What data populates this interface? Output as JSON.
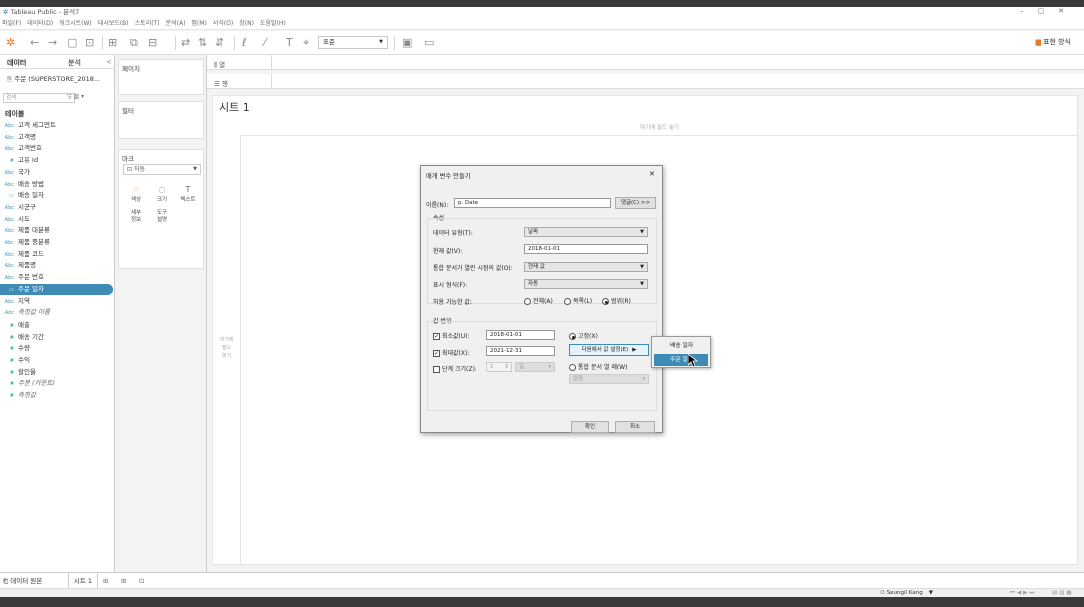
{
  "app": {
    "title": "Tableau Public - 분석7",
    "win_min": "–",
    "win_max": "▢",
    "win_close": "✕"
  },
  "menu": [
    "파일(F)",
    "데이터(D)",
    "워크시트(W)",
    "대시보드(B)",
    "스토리(T)",
    "분석(A)",
    "맵(M)",
    "서식(O)",
    "창(N)",
    "도움말(H)"
  ],
  "toolbar": {
    "font_select": "표준",
    "showme_label": "표현 방식"
  },
  "data_pane": {
    "tab_data": "데이터",
    "tab_analysis": "분석",
    "collapse": "<",
    "datasource": "주문 (SUPERSTORE_2018...",
    "search_placeholder": "검색",
    "tables_header": "테이블",
    "fields": [
      {
        "icon": "Abc",
        "name": "고객 세그먼트",
        "kind": "dim"
      },
      {
        "icon": "Abc",
        "name": "고객명",
        "kind": "dim"
      },
      {
        "icon": "Abc",
        "name": "고객번호",
        "kind": "dim"
      },
      {
        "icon": "#",
        "name": "고유 Id",
        "kind": "dim"
      },
      {
        "icon": "Abc",
        "name": "국가",
        "kind": "dim"
      },
      {
        "icon": "Abc",
        "name": "배송 방법",
        "kind": "dim"
      },
      {
        "icon": "▭",
        "name": "배송 일자",
        "kind": "date"
      },
      {
        "icon": "Abc",
        "name": "시군구",
        "kind": "dim"
      },
      {
        "icon": "Abc",
        "name": "시도",
        "kind": "dim"
      },
      {
        "icon": "Abc",
        "name": "제품 대분류",
        "kind": "dim"
      },
      {
        "icon": "Abc",
        "name": "제품 중분류",
        "kind": "dim"
      },
      {
        "icon": "Abc",
        "name": "제품 코드",
        "kind": "dim"
      },
      {
        "icon": "Abc",
        "name": "제품명",
        "kind": "dim"
      },
      {
        "icon": "Abc",
        "name": "주문 번호",
        "kind": "dim"
      },
      {
        "icon": "▭",
        "name": "주문 일자",
        "kind": "date",
        "selected": true
      },
      {
        "icon": "Abc",
        "name": "지역",
        "kind": "dim"
      },
      {
        "icon": "Abc",
        "name": "측정값 이름",
        "kind": "dim",
        "italic": true
      },
      {
        "icon": "#",
        "name": "매출",
        "kind": "meas"
      },
      {
        "icon": "#",
        "name": "배송 기간",
        "kind": "meas"
      },
      {
        "icon": "#",
        "name": "수량",
        "kind": "meas"
      },
      {
        "icon": "#",
        "name": "수익",
        "kind": "meas"
      },
      {
        "icon": "#",
        "name": "할인율",
        "kind": "meas"
      },
      {
        "icon": "#",
        "name": "주문 (카운트)",
        "kind": "meas",
        "italic": true
      },
      {
        "icon": "#",
        "name": "측정값",
        "kind": "meas",
        "italic": true
      }
    ]
  },
  "shelves": {
    "pages": "페이지",
    "filters": "필터",
    "marks": "마크",
    "marks_type": "자동",
    "mark_buttons": [
      {
        "glyph": "⁘",
        "label": "색상"
      },
      {
        "glyph": "◌",
        "label": "크기"
      },
      {
        "glyph": "T",
        "label": "텍스트"
      },
      {
        "glyph": "",
        "label": "세부\n정보"
      },
      {
        "glyph": "",
        "label": "도구\n설명"
      }
    ],
    "columns": "열",
    "rows": "행"
  },
  "view": {
    "sheet_title": "시트 1",
    "drop_top": "여기에 필드 놓기",
    "drop_left": "여기에\n필드\n놓기"
  },
  "bottom": {
    "data_source_tab": "데이터 원본",
    "sheet_tab": "시트 1"
  },
  "status": {
    "user": "Seungil Kang"
  },
  "dialog": {
    "title": "매개 변수 만들기",
    "close": "✕",
    "name_label": "이름(N):",
    "name_value": "p. Date",
    "comment_button": "댓글(C) >>",
    "properties_label": "속성",
    "datatype_label": "데이터 유형(T):",
    "datatype_value": "날짜",
    "current_label": "현재 값(V):",
    "current_value": "2018-01-01",
    "workbook_label": "통합 문서가 열린 시점의 값(O):",
    "workbook_value": "현재 값",
    "display_label": "표시 형식(F):",
    "display_value": "자동",
    "allowable_label": "허용 가능한 값:",
    "allow_all": "전체(A)",
    "allow_list": "목록(L)",
    "allow_range": "범위(R)",
    "range_label": "값 범위",
    "min_label": "최소값(U):",
    "min_value": "2018-01-01",
    "max_label": "최대값(X):",
    "max_value": "2021-12-31",
    "step_label": "단계 크기(Z):",
    "step_value": "1",
    "step_unit": "일",
    "fixed_label": "고정(X)",
    "set_from_button": "다음에서 값 설정(E)",
    "when_open_label": "통합 문서 열 때(W)",
    "when_open_select": "없음",
    "ok": "확인",
    "cancel": "취소"
  },
  "context_menu": {
    "items": [
      "배송 일자",
      "주문 일자"
    ],
    "highlighted": 1
  }
}
